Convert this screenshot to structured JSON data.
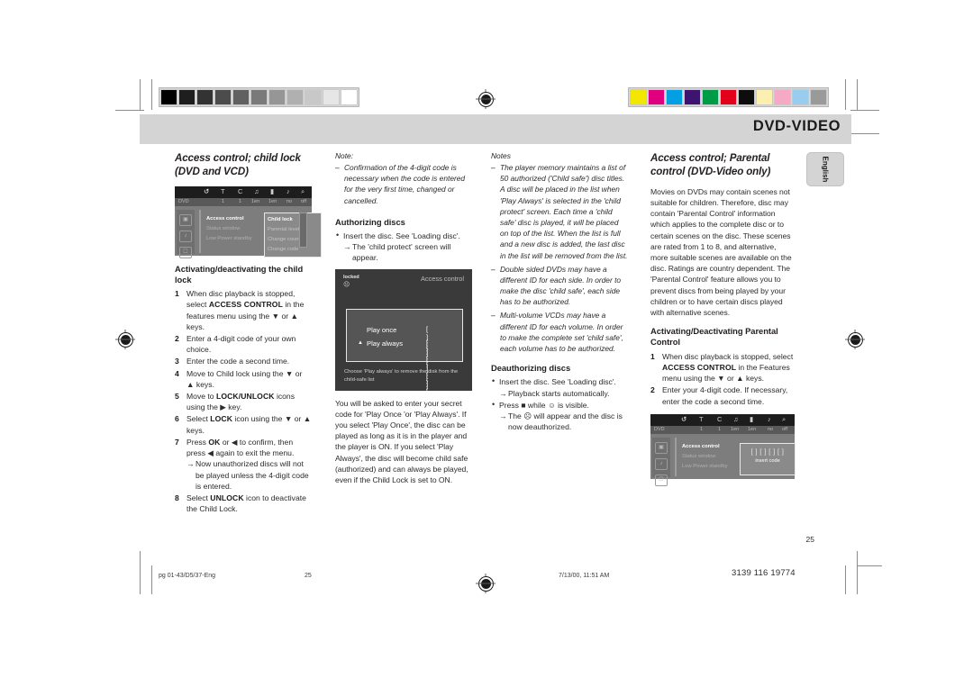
{
  "header": {
    "title": "DVD-VIDEO",
    "language_tab": "English"
  },
  "calibration": {
    "gray_ramp": [
      "#000000",
      "#1e1e1e",
      "#333333",
      "#4c4c4c",
      "#616161",
      "#7a7a7a",
      "#969696",
      "#b0b0b0",
      "#c8c8c8",
      "#e6e6e6",
      "#ffffff"
    ],
    "color_bars": [
      "#f3e600",
      "#e0007f",
      "#00a0e2",
      "#3d1470",
      "#009b47",
      "#e2001a",
      "#0d0d0d",
      "#fbf0b0",
      "#f6a9c4",
      "#98cdf0",
      "#9a9a9a"
    ]
  },
  "columns": {
    "one": {
      "heading": "Access control; child lock (DVD and VCD)",
      "sub_heading": "Activating/deactivating the child lock",
      "steps": [
        {
          "n": "1",
          "parts": [
            "When disc playback is stopped, select ",
            "ACCESS CONTROL",
            " in the features menu using the ▼ or ▲ keys."
          ]
        },
        {
          "n": "2",
          "parts": [
            "Enter a 4-digit code of your own choice."
          ]
        },
        {
          "n": "3",
          "parts": [
            "Enter the code a second time."
          ]
        },
        {
          "n": "4",
          "parts": [
            "Move to Child lock using the ▼ or ▲ keys."
          ]
        },
        {
          "n": "5",
          "parts": [
            "Move to ",
            "LOCK/UNLOCK",
            " icons using the ▶ key."
          ]
        },
        {
          "n": "6",
          "parts": [
            "Select ",
            "LOCK",
            " icon using the ▼ or ▲ keys."
          ]
        },
        {
          "n": "7",
          "parts": [
            "Press ",
            "OK",
            " or ◀ to confirm, then press ◀ again to exit the menu."
          ],
          "arrow": "Now unauthorized discs will not be played unless the 4-digit code is entered."
        },
        {
          "n": "8",
          "parts": [
            "Select ",
            "UNLOCK",
            " icon to deactivate the Child Lock."
          ]
        }
      ]
    },
    "two": {
      "note_label": "Note:",
      "note_text": "Confirmation of the 4-digit code is necessary when the code is entered for the very first time, changed or cancelled.",
      "sub_heading": "Authorizing discs",
      "bullet": "Insert the disc. See 'Loading disc'.",
      "bullet_arrow": "The 'child protect' screen will appear.",
      "paragraph": "You will be asked to enter your secret code for 'Play Once 'or 'Play Always'. If you select 'Play Once', the disc can be played as long as it is in the player and the player is ON. If you select 'Play Always', the disc will become child safe (authorized) and can always be played, even if the Child Lock is set to ON."
    },
    "three": {
      "notes_label": "Notes",
      "notes": [
        "The player memory maintains a list of 50 authorized ('Child safe') disc titles. A disc will be placed in the list when 'Play Always' is selected in the 'child protect' screen. Each time a 'child safe' disc is played, it will be placed on top of the list. When the list is full and a new disc is added, the last disc in the list will be removed from the list.",
        "Double sided DVDs may have a different ID for each side. In order to make the disc 'child safe', each side has to be authorized.",
        "Multi-volume VCDs may have a different ID for each volume. In order to make the complete set 'child safe', each volume has to be authorized."
      ],
      "sub_heading": "Deauthorizing discs",
      "bullets": [
        {
          "text": "Insert the disc. See 'Loading disc'.",
          "arrow": "Playback starts automatically."
        },
        {
          "text": "Press ■ while ☺ is visible.",
          "arrow": "The ☹ will appear and the disc is now deauthorized."
        }
      ]
    },
    "four": {
      "heading": "Access control; Parental control (DVD-Video only)",
      "paragraph": "Movies on DVDs may contain scenes not suitable for children. Therefore, disc may contain 'Parental Control' information which applies to the complete disc or to certain scenes on the disc. These scenes are rated from 1 to 8, and alternative, more suitable scenes are available on the disc. Ratings are country dependent. The 'Parental Control' feature allows you to prevent discs from being played by your children or to have certain discs played with alternative scenes.",
      "sub_heading": "Activating/Deactivating Parental Control",
      "steps": [
        {
          "n": "1",
          "parts": [
            "When disc playback is stopped, select ",
            "ACCESS CONTROL",
            " in the Features menu using the ▼ or ▲ keys."
          ]
        },
        {
          "n": "2",
          "parts": [
            "Enter your 4-digit code. If necessary, enter the code a second time."
          ]
        }
      ]
    }
  },
  "osd_menu_1": {
    "icons": [
      "↺",
      "T",
      "C",
      "♪",
      "⬜",
      "♪",
      "⌕"
    ],
    "sub_values": [
      "DVD",
      "1",
      "1",
      "1en",
      "1en",
      "no",
      "off"
    ],
    "menu_left": [
      "Access control",
      "Status window",
      "Low Power standby"
    ],
    "menu_right": [
      "Child lock",
      "Parental level",
      "Change country",
      "Change code"
    ],
    "selected_left": "Access control",
    "selected_right": "Child lock"
  },
  "osd_menu_2": {
    "icons": [
      "↺",
      "T",
      "C",
      "♪",
      "⬜",
      "♪",
      "⌕"
    ],
    "sub_values": [
      "DVD",
      "1",
      "1",
      "1en",
      "1en",
      "no",
      "off"
    ],
    "menu_left": [
      "Access control",
      "Status window",
      "Low Power standby"
    ],
    "selected_left": "Access control",
    "code_boxes": "[ ] [ ] [ ] [ ]",
    "code_caption": "insert code"
  },
  "child_protect_screen": {
    "lock_label": "locked",
    "lock_glyph": "☹",
    "title": "Access control",
    "option_once": "Play once",
    "option_always": "Play always",
    "digits": "[ ] [ ] [ ] [ ]",
    "cursor": "▲",
    "footer": "Choose 'Play always' to remove the disk from the child-safe list"
  },
  "page": {
    "number": "25",
    "footer_file": "pg 01-43/D5/37-Eng",
    "footer_page": "25",
    "footer_date": "7/13/00, 11:51 AM",
    "footer_code": "3139 116 19774"
  }
}
